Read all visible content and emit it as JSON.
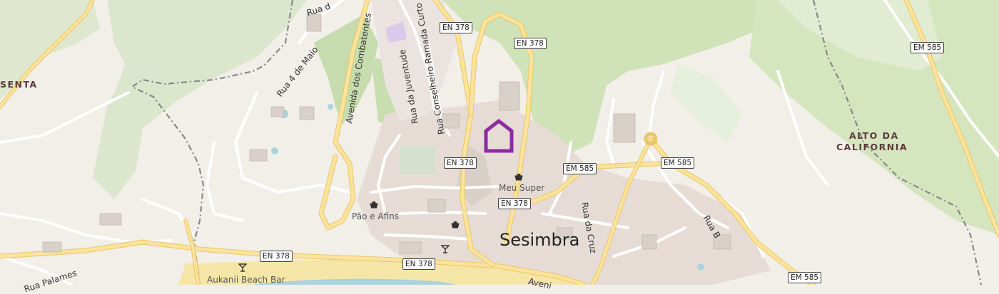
{
  "map": {
    "places": {
      "senta": "SENTA",
      "alto_line1": "ALTO DA",
      "alto_line2": "CALIFORNIA",
      "town": "Sesimbra"
    },
    "route_shields": {
      "en378_a": "EN 378",
      "en378_b": "EN 378",
      "en378_c": "EN 378",
      "en378_d": "EN 378",
      "en378_e": "EN 378",
      "en378_f": "EN 378",
      "em585_a": "EM 585",
      "em585_b": "EM 585",
      "em585_c": "EM 585",
      "em585_d": "EM 585"
    },
    "streets": {
      "rua_4_de_maio": "Rua 4 de Maio",
      "avenida_combatentes": "Avenida dos Combatentes",
      "rua_conselheiro": "Rua Conselheiro Ramada Curto",
      "rua_juventude": "Rua da Juventude",
      "rua_da_cruz": "Rua da Cruz",
      "rua_b": "Rua B",
      "rua_top": "Rua d",
      "rua_palames": "Rua Palames",
      "avenida_bottom": "Aveni"
    },
    "pois": {
      "pao_e_afins": "Pão e Afins",
      "meu_super": "Meu Super",
      "aukanii": "Aukanii Beach Bar"
    },
    "marker": {
      "color": "#8e2ba0",
      "icon": "home-marker-icon"
    }
  }
}
